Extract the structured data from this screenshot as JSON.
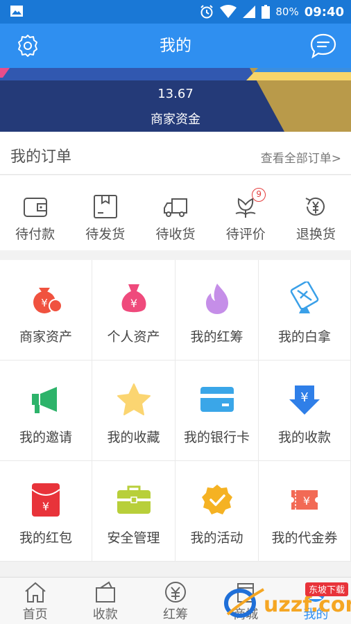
{
  "status_bar": {
    "battery_percent": "80%",
    "time": "09:40"
  },
  "header": {
    "title": "我的"
  },
  "banner": {
    "value": "13.67",
    "label": "商家资金"
  },
  "orders": {
    "title": "我的订单",
    "view_all": "查看全部订单>",
    "items": [
      {
        "label": "待付款",
        "icon": "wallet-icon"
      },
      {
        "label": "待发货",
        "icon": "package-icon"
      },
      {
        "label": "待收货",
        "icon": "truck-icon"
      },
      {
        "label": "待评价",
        "icon": "flower-icon",
        "badge": "9"
      },
      {
        "label": "退换货",
        "icon": "yuan-return-icon"
      }
    ]
  },
  "grid": [
    {
      "label": "商家资产",
      "icon": "money-bag-icon",
      "color": "#f0523f"
    },
    {
      "label": "个人资产",
      "icon": "yuan-bag-icon",
      "color": "#ef4a7c"
    },
    {
      "label": "我的红筹",
      "icon": "flame-icon",
      "color": "#c58ee8"
    },
    {
      "label": "我的白拿",
      "icon": "ticket-icon",
      "color": "#3aa0e8"
    },
    {
      "label": "我的邀请",
      "icon": "megaphone-icon",
      "color": "#2db36a"
    },
    {
      "label": "我的收藏",
      "icon": "star-icon",
      "color": "#fbd571"
    },
    {
      "label": "我的银行卡",
      "icon": "bank-card-icon",
      "color": "#3aa6e8"
    },
    {
      "label": "我的收款",
      "icon": "download-yuan-icon",
      "color": "#2f7fe8"
    },
    {
      "label": "我的红包",
      "icon": "red-envelope-icon",
      "color": "#e8333a"
    },
    {
      "label": "安全管理",
      "icon": "briefcase-icon",
      "color": "#b8cf3a"
    },
    {
      "label": "我的活动",
      "icon": "check-badge-icon",
      "color": "#f5b223"
    },
    {
      "label": "我的代金券",
      "icon": "voucher-icon",
      "color": "#f26a55"
    }
  ],
  "tabbar": [
    {
      "label": "首页",
      "icon": "home-icon",
      "active": false
    },
    {
      "label": "收款",
      "icon": "receive-icon",
      "active": false
    },
    {
      "label": "红筹",
      "icon": "yuan-circle-icon",
      "active": false
    },
    {
      "label": "商城",
      "icon": "shop-icon",
      "active": false
    },
    {
      "label": "我的",
      "icon": "profile-icon",
      "active": true
    }
  ],
  "watermark": {
    "site": "uzzf.com",
    "tag": "东坡下载"
  }
}
